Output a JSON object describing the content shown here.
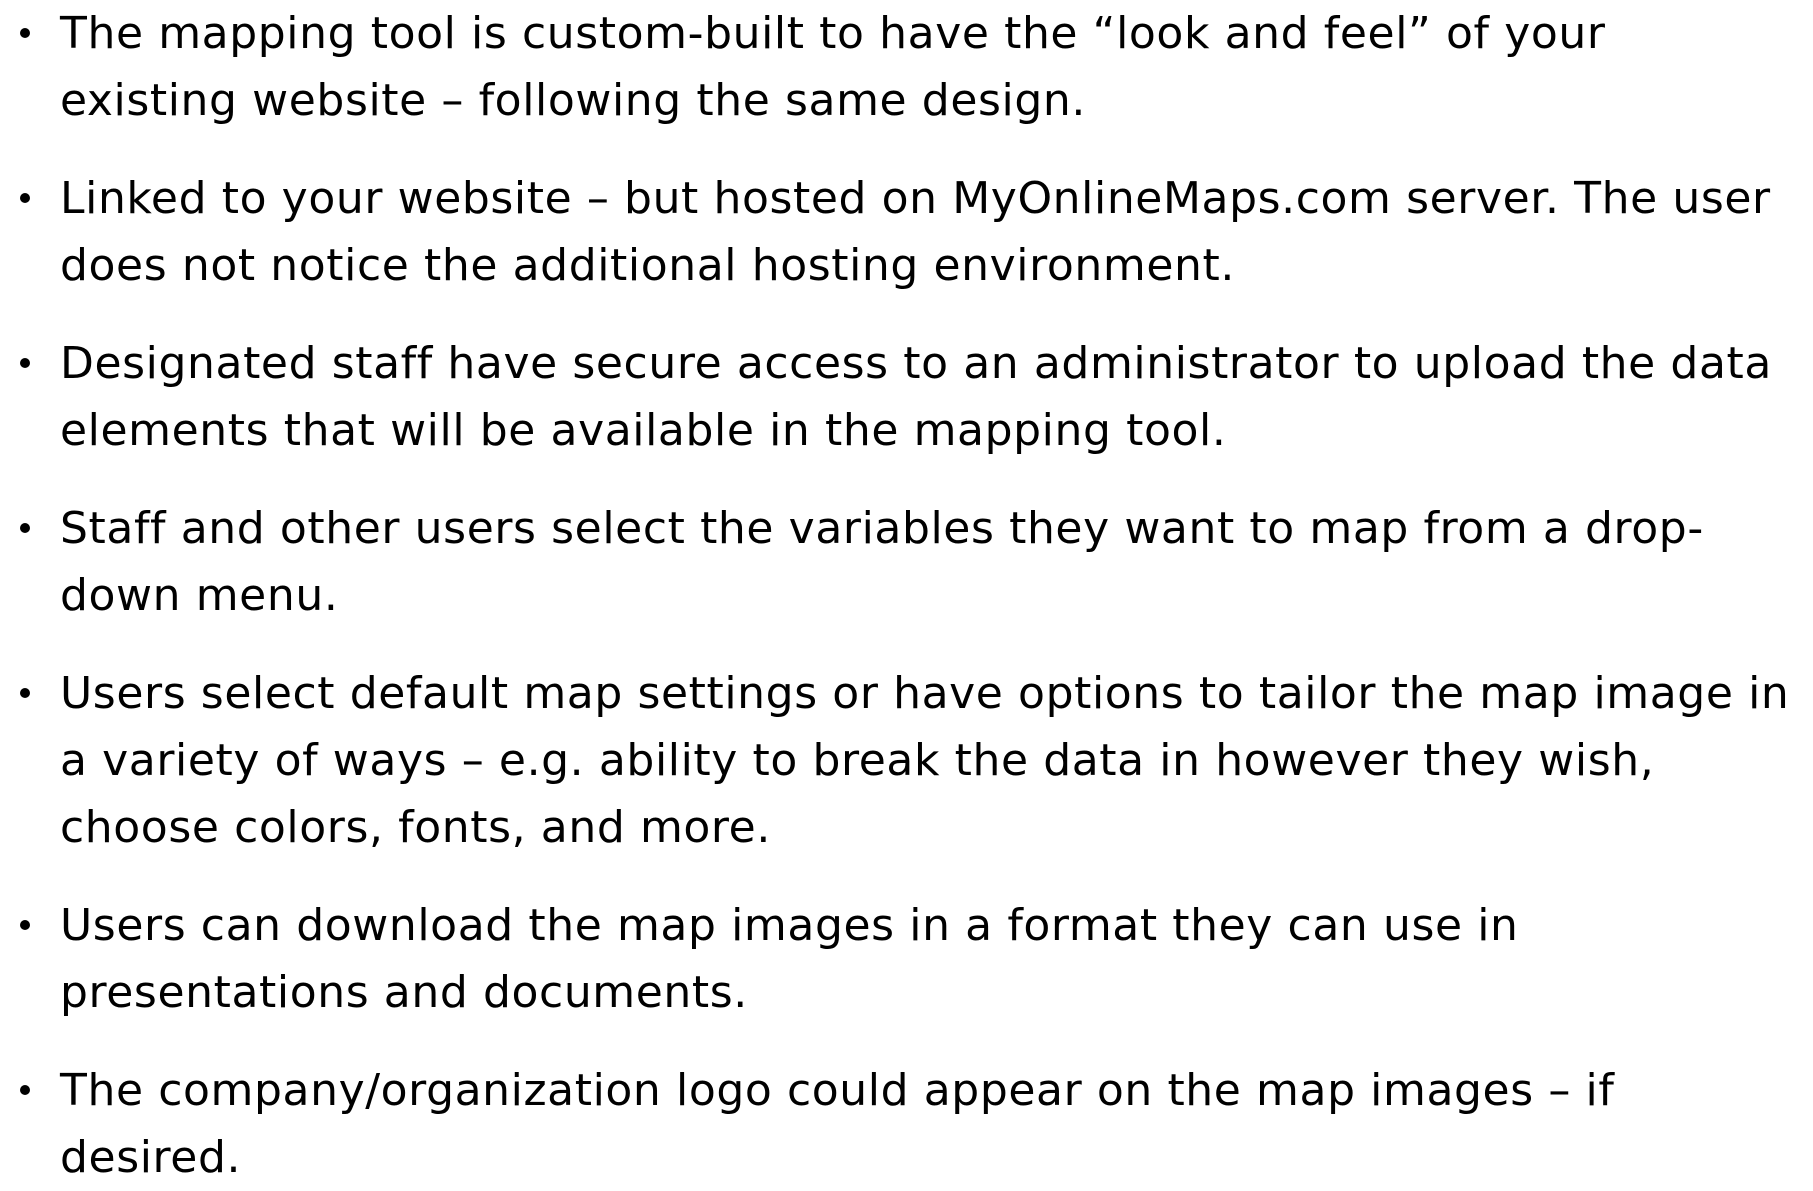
{
  "bullets": [
    {
      "text": "The mapping tool is custom-built to have the “look and feel” of your\nexisting website – following the same design."
    },
    {
      "text": "Linked to your website – but hosted on MyOnlineMaps.com server.  The user\ndoes not notice the additional hosting environment."
    },
    {
      "text": "Designated staff have secure access to an administrator to upload the data\nelements that will be available in the mapping tool."
    },
    {
      "text": "Staff and other users select the variables they want to map from a drop-\ndown menu."
    },
    {
      "text": "Users select default map settings or have options to tailor the map image in\na variety of ways – e.g. ability to break the data in however they wish,\nchoose colors, fonts, and more."
    },
    {
      "text": "Users can download the map images in a format they can use in\npresentations and documents."
    },
    {
      "text": "The company/organization logo could appear on the map images – if\ndesired."
    }
  ]
}
